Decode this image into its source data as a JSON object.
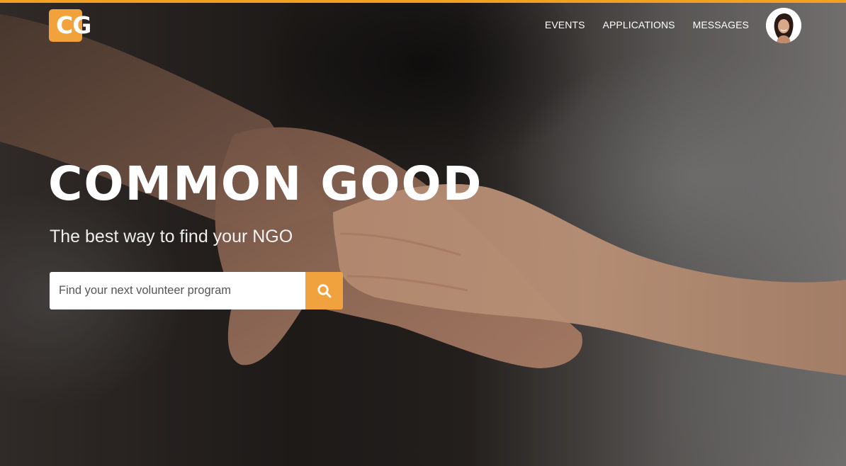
{
  "brand": {
    "logo_text": "CG",
    "accent_color": "#f29f22",
    "logo_color": "#f2a23a"
  },
  "nav": {
    "items": [
      {
        "label": "EVENTS"
      },
      {
        "label": "APPLICATIONS"
      },
      {
        "label": "MESSAGES"
      }
    ],
    "avatar_icon": "user-avatar"
  },
  "hero": {
    "title": "COMMON GOOD",
    "subtitle": "The best way to find your NGO",
    "background": "hands-photo"
  },
  "search": {
    "placeholder": "Find your next volunteer program",
    "value": "",
    "button_icon": "search-icon",
    "button_color": "#f0a23e"
  }
}
